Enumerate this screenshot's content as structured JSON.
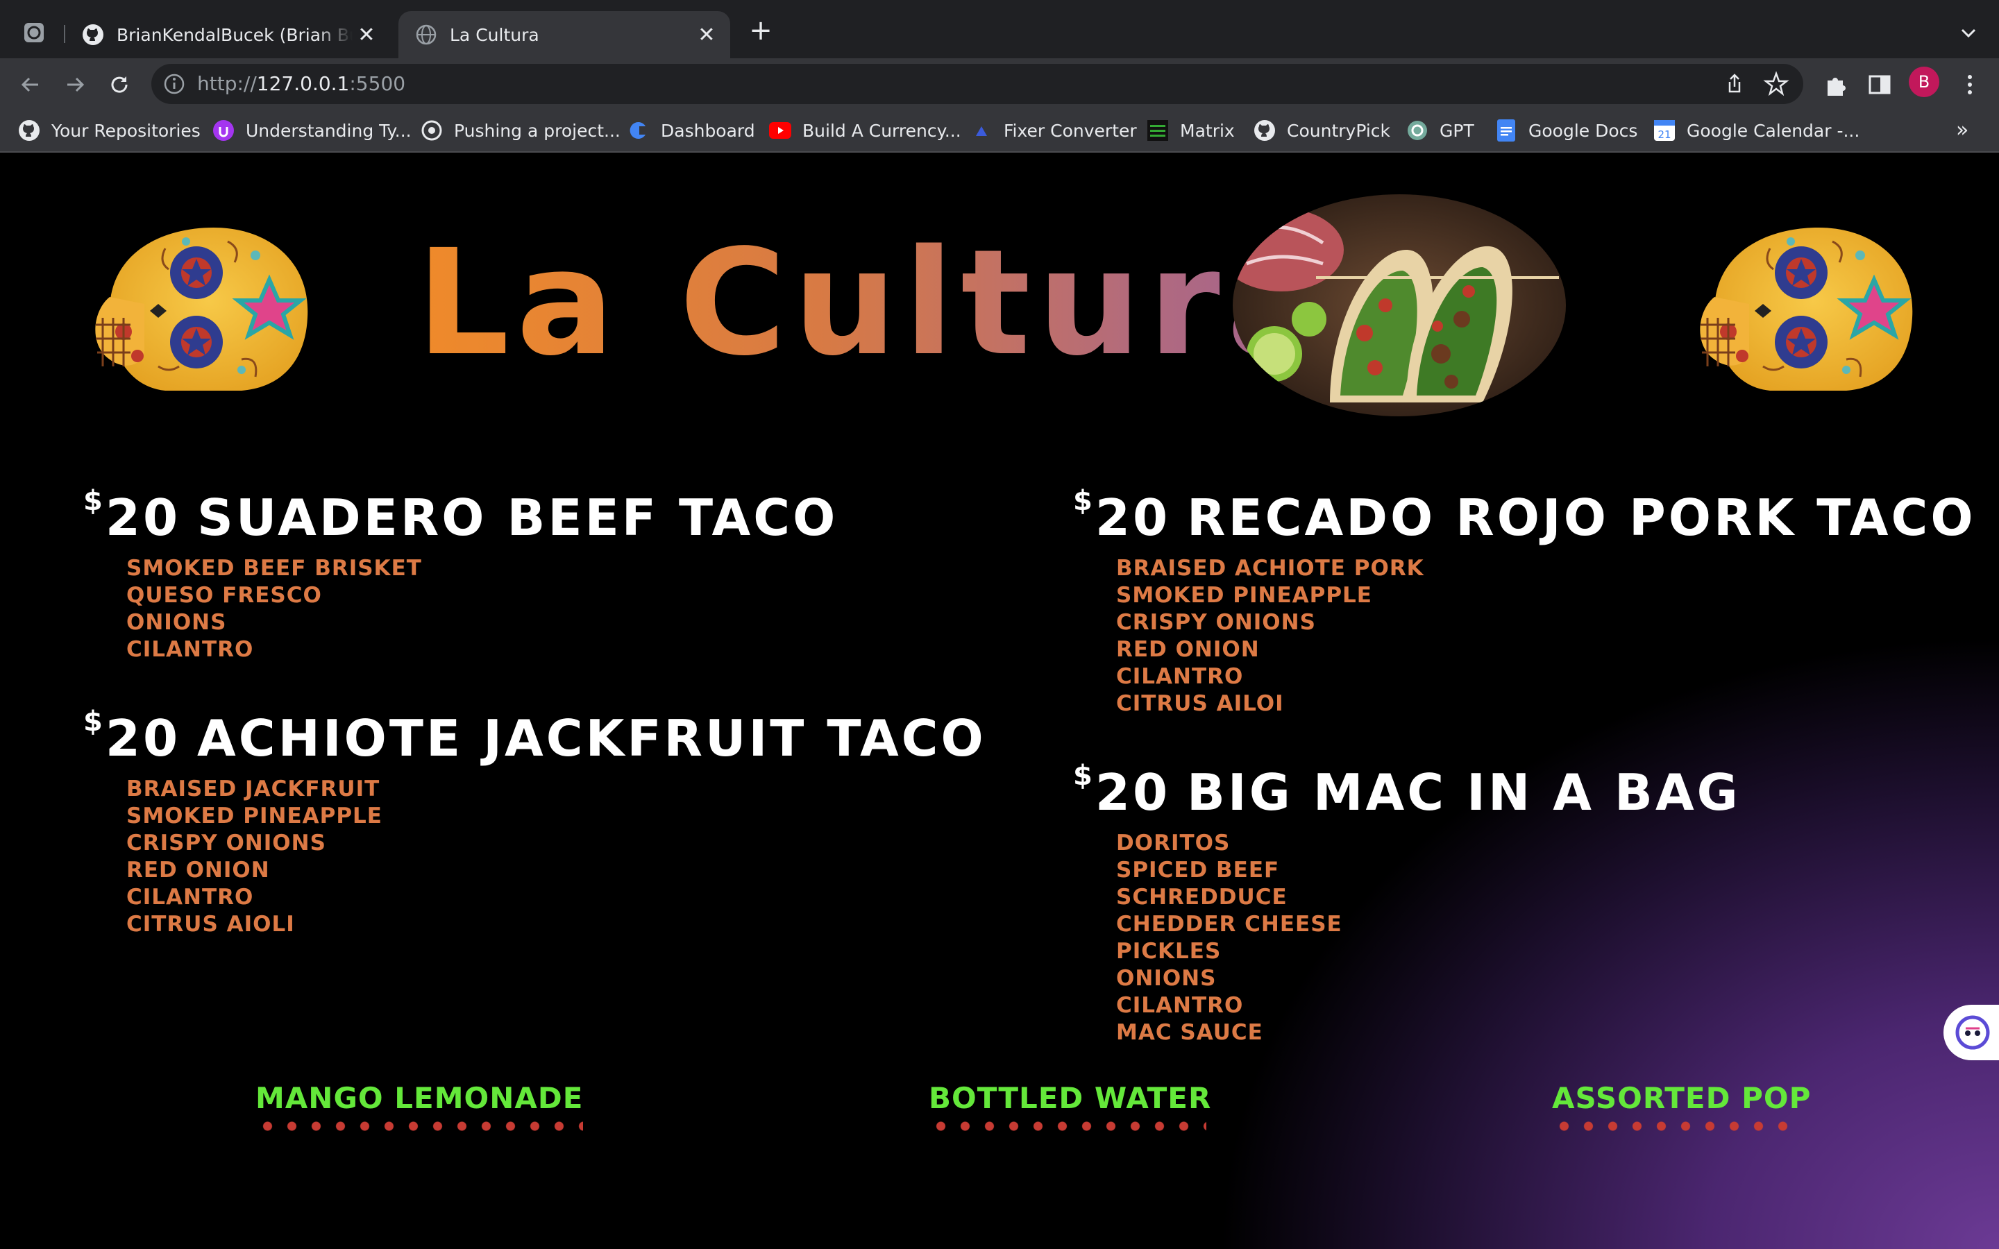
{
  "browser": {
    "tabs": [
      {
        "title": "BrianKendalBucek (Brian Bucek)",
        "active": false
      },
      {
        "title": "La Cultura",
        "active": true
      }
    ],
    "url_scheme": "http://",
    "url_host": "127.0.0.1",
    "url_port": ":5500",
    "profile_initial": "B",
    "bookmarks": [
      {
        "label": "Your Repositories",
        "icon": "github-icon"
      },
      {
        "label": "Understanding Ty...",
        "icon": "udemy-icon"
      },
      {
        "label": "Pushing a project...",
        "icon": "target-icon"
      },
      {
        "label": "Dashboard",
        "icon": "dashboard-icon"
      },
      {
        "label": "Build A Currency...",
        "icon": "youtube-icon"
      },
      {
        "label": "Fixer Converter",
        "icon": "fixer-icon"
      },
      {
        "label": "Matrix",
        "icon": "matrix-icon"
      },
      {
        "label": "CountryPick",
        "icon": "github-icon"
      },
      {
        "label": "GPT",
        "icon": "openai-icon"
      },
      {
        "label": "Google Docs",
        "icon": "google-docs-icon"
      },
      {
        "label": "Google Calendar -...",
        "icon": "google-calendar-icon"
      }
    ],
    "bookmarks_more": "»",
    "accent_colors": {
      "tabstrip": "#1f2023",
      "toolbar": "#35363a",
      "profile": "#c2185b"
    }
  },
  "page": {
    "brand": "La Cultura",
    "colors": {
      "heading": "#ffffff",
      "ingredient": "#dd7a45",
      "drink": "#64e83a",
      "dots": "#c73b33",
      "gradient_purple": "#6b3a94"
    },
    "menu_left": [
      {
        "price_symbol": "$",
        "price": "20",
        "name": "SUADERO BEEF TACO",
        "ingredients": [
          "SMOKED BEEF BRISKET",
          "QUESO FRESCO",
          "ONIONS",
          "CILANTRO"
        ]
      },
      {
        "price_symbol": "$",
        "price": "20",
        "name": "ACHIOTE JACKFRUIT TACO",
        "ingredients": [
          "BRAISED JACKFRUIT",
          "SMOKED PINEAPPLE",
          "CRISPY ONIONS",
          "RED ONION",
          "CILANTRO",
          "CITRUS AIOLI"
        ]
      }
    ],
    "menu_right": [
      {
        "price_symbol": "$",
        "price": "20",
        "name": "RECADO ROJO PORK TACO",
        "ingredients": [
          "BRAISED ACHIOTE PORK",
          "SMOKED PINEAPPLE",
          "CRISPY ONIONS",
          "RED ONION",
          "CILANTRO",
          "CITRUS AILOI"
        ]
      },
      {
        "price_symbol": "$",
        "price": "20",
        "name": "BIG MAC IN A BAG",
        "ingredients": [
          "DORITOS",
          "SPICED BEEF",
          "SCHREDDUCE",
          "CHEDDER CHEESE",
          "PICKLES",
          "ONIONS",
          "CILANTRO",
          "MAC SAUCE"
        ]
      }
    ],
    "drinks": [
      "MANGO LEMONADE",
      "BOTTLED WATER",
      "ASSORTED POP"
    ]
  }
}
